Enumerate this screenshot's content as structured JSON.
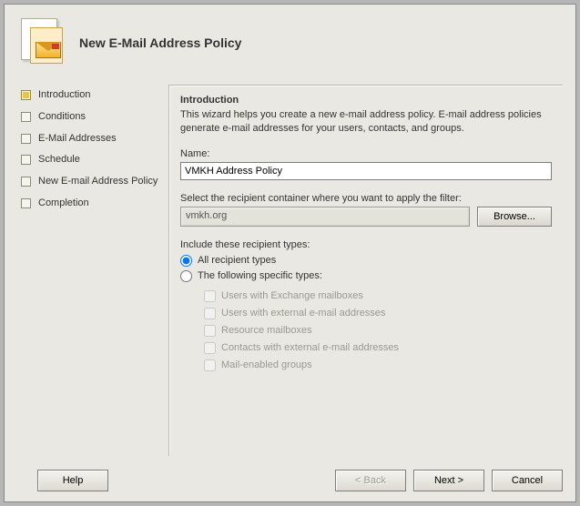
{
  "header": {
    "title": "New E-Mail Address Policy"
  },
  "sidebar": {
    "items": [
      {
        "label": "Introduction",
        "active": true
      },
      {
        "label": "Conditions",
        "active": false
      },
      {
        "label": "E-Mail Addresses",
        "active": false
      },
      {
        "label": "Schedule",
        "active": false
      },
      {
        "label": "New E-mail Address Policy",
        "active": false
      },
      {
        "label": "Completion",
        "active": false
      }
    ]
  },
  "content": {
    "section_title": "Introduction",
    "description": "This wizard helps you create a new e-mail address policy. E-mail address policies generate e-mail addresses for your users, contacts, and groups.",
    "name_label": "Name:",
    "name_value": "VMKH Address Policy",
    "filter_label": "Select the recipient container where you want to apply the filter:",
    "filter_value": "vmkh.org",
    "browse_label": "Browse...",
    "include_label": "Include these recipient types:",
    "radio_all": "All recipient types",
    "radio_specific": "The following specific types:",
    "checks": [
      "Users with Exchange mailboxes",
      "Users with external e-mail addresses",
      "Resource mailboxes",
      "Contacts with external e-mail addresses",
      "Mail-enabled groups"
    ]
  },
  "footer": {
    "help": "Help",
    "back": "< Back",
    "next": "Next >",
    "cancel": "Cancel"
  }
}
